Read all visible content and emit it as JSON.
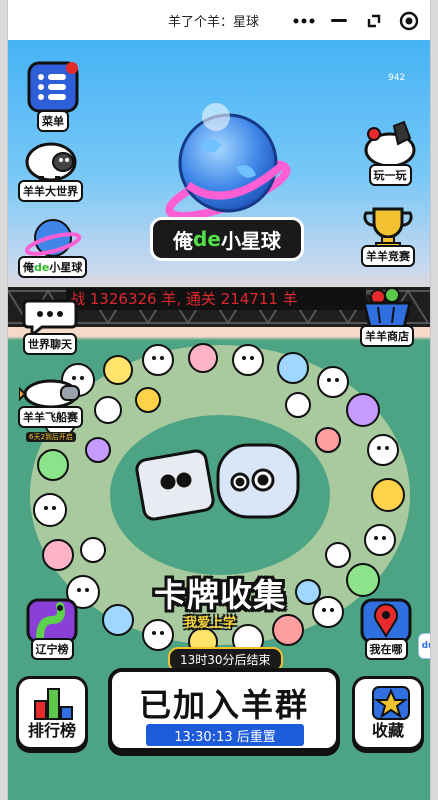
{
  "window": {
    "title": "羊了个羊：星球",
    "more_icon": "more-dots-icon",
    "minimize_icon": "minimize-icon",
    "restore_icon": "restore-icon",
    "close_icon": "record-close-icon"
  },
  "game": {
    "counter": "942",
    "planet_label_prefix": "俺",
    "planet_label_de": "de",
    "planet_label_suffix": "小星球",
    "ticker": "战 1326326 羊, 通关 214711 羊",
    "left_buttons": [
      {
        "label": "菜单",
        "icon": "menu-list-icon"
      },
      {
        "label": "羊羊大世界",
        "icon": "sheep-world-icon"
      },
      {
        "label": "俺de小星球",
        "icon": "planet-icon"
      },
      {
        "label": "世界聊天",
        "icon": "chat-bubble-icon"
      },
      {
        "label": "羊羊飞船赛",
        "icon": "rocket-sheep-icon",
        "sub": "6天2到后开启"
      }
    ],
    "right_buttons": [
      {
        "label": "玩一玩",
        "icon": "play-cat-icon"
      },
      {
        "label": "羊羊竞赛",
        "icon": "trophy-icon"
      },
      {
        "label": "羊羊商店",
        "icon": "shop-basket-icon"
      }
    ],
    "card_collect_title": "卡牌收集",
    "card_collect_sub": "我爱上学",
    "region_rank": {
      "label": "辽宁榜",
      "icon": "snake-mascot-icon"
    },
    "where_am_i": {
      "label": "我在哪",
      "icon": "location-pin-icon"
    },
    "countdown": "13时30分后结束",
    "join_label": "已加入羊群",
    "reset_label": "13:30:13 后重置",
    "ranking": {
      "label": "排行榜",
      "icon": "bar-chart-icon"
    },
    "favorite": {
      "label": "收藏",
      "icon": "star-icon"
    },
    "side_tab": "du"
  },
  "colors": {
    "sky_top": "#46b3f5",
    "ground": "#4da484",
    "ticker_text": "#e0282f",
    "join_reset_bg": "#1e5bd8",
    "gold": "#f2c230"
  }
}
